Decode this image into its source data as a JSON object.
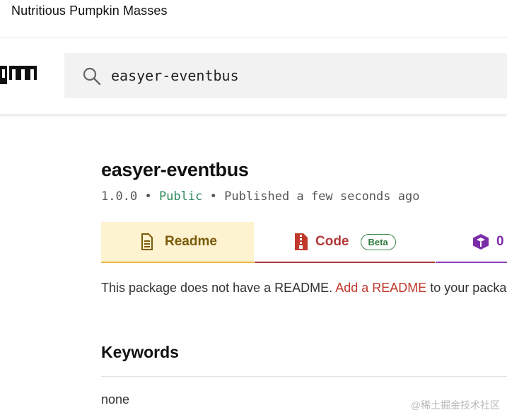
{
  "banner": {
    "text": "Nutritious Pumpkin Masses"
  },
  "search": {
    "value": "easyer-eventbus"
  },
  "package": {
    "name": "easyer-eventbus",
    "version": "1.0.0",
    "visibility": "Public",
    "published": "Published a few seconds ago",
    "separator": "•"
  },
  "tabs": {
    "readme_label": "Readme",
    "code_label": "Code",
    "code_badge": "Beta",
    "deps_label": "0"
  },
  "readme": {
    "prefix": "This package does not have a README.",
    "link": "Add a README",
    "suffix": "to your package"
  },
  "keywords": {
    "heading": "Keywords",
    "value": "none"
  },
  "watermark": {
    "text": "@稀土掘金技术社区"
  },
  "colors": {
    "readme_tab_bg": "#fef3d0",
    "readme_tab_accent": "#f0b849",
    "code_accent": "#b33a3a",
    "deps_accent": "#8b3dbf",
    "public_green": "#2c8a5a",
    "link_red": "#c0392b"
  },
  "icons": {
    "logo": "npm-logo",
    "search": "search-icon",
    "readme": "document-icon",
    "code": "zip-file-icon",
    "deps": "cube-icon"
  }
}
